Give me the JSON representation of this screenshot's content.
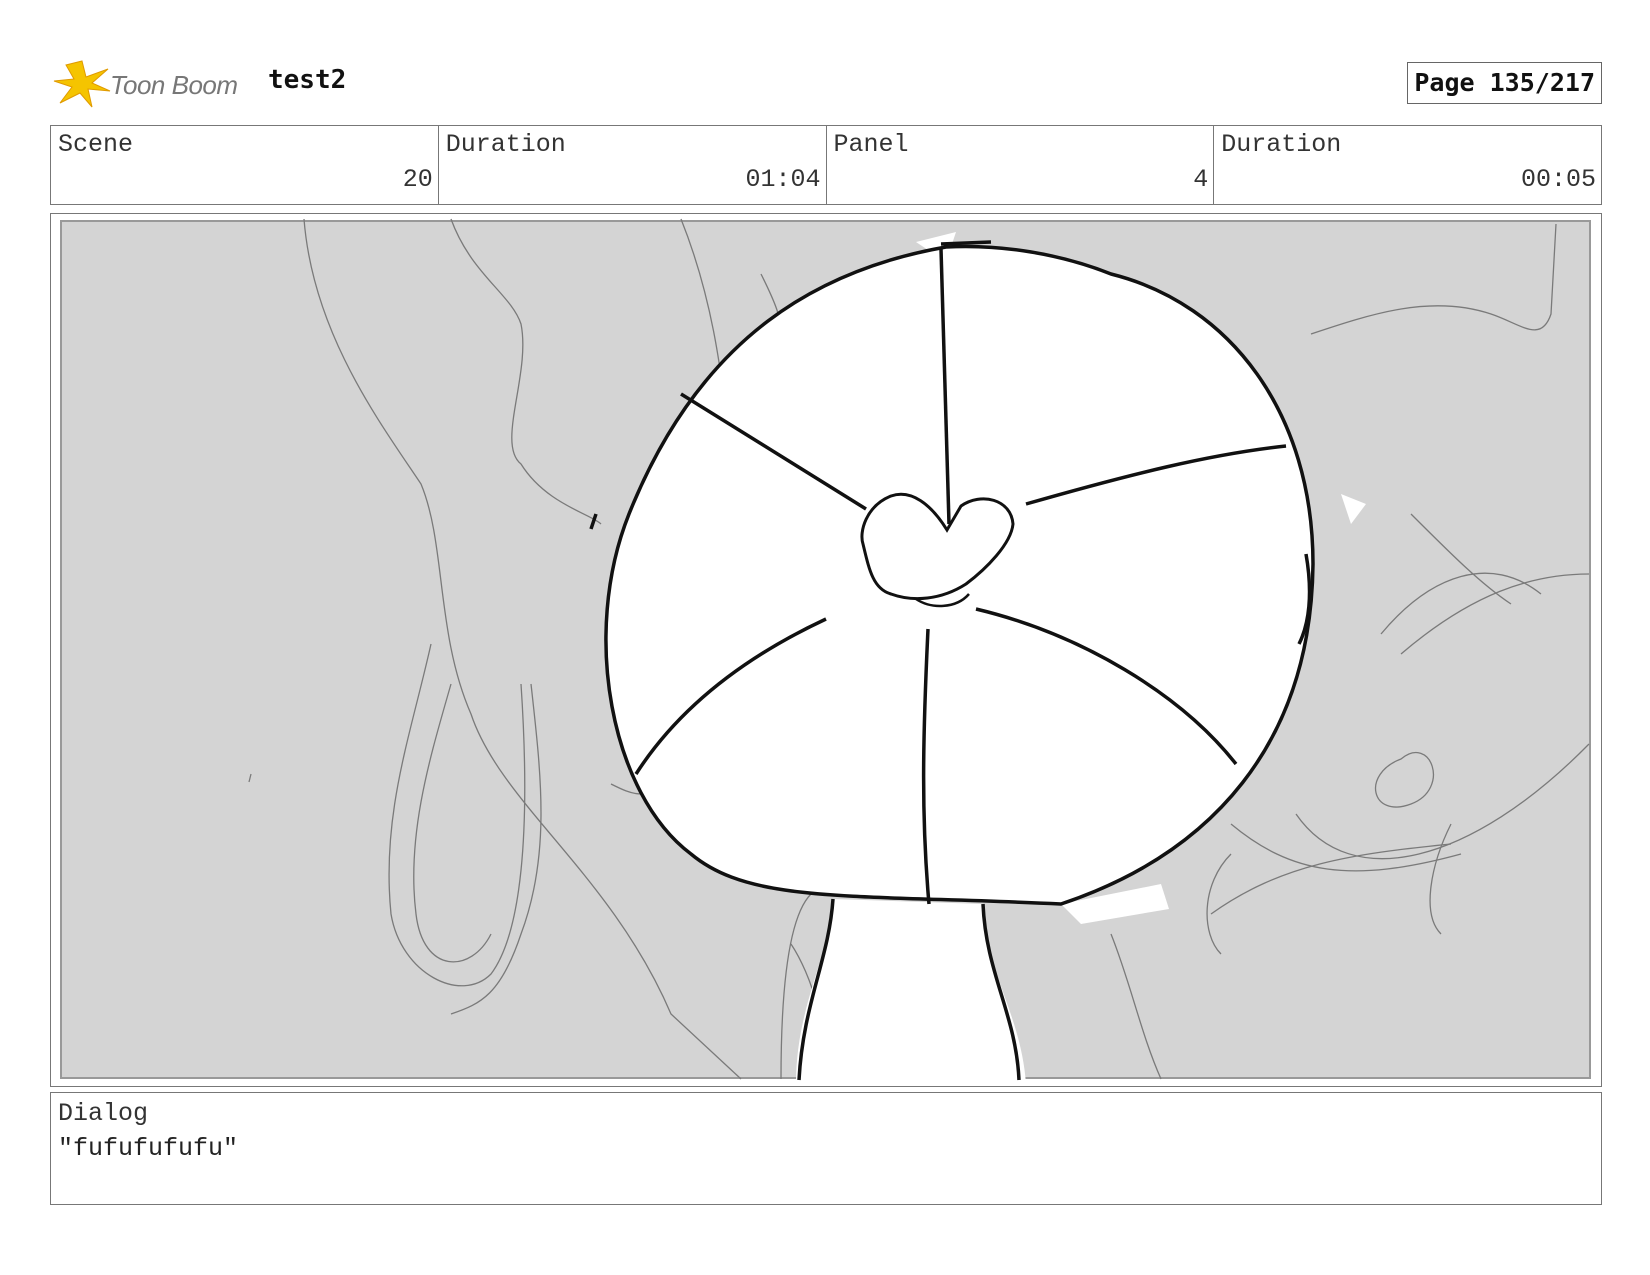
{
  "header": {
    "logo_text": "Toon Boom",
    "project_title": "test2",
    "page_label": "Page 135/217"
  },
  "info": {
    "scene_label": "Scene",
    "scene_value": "20",
    "scene_duration_label": "Duration",
    "scene_duration_value": "01:04",
    "panel_label": "Panel",
    "panel_value": "4",
    "panel_duration_label": "Duration",
    "panel_duration_value": "00:05"
  },
  "dialog": {
    "label": "Dialog",
    "text": "\"fufufufufu\""
  },
  "colors": {
    "logo_star": "#f5c400",
    "panel_background": "#d4d4d4",
    "sketch_line": "#111111"
  }
}
